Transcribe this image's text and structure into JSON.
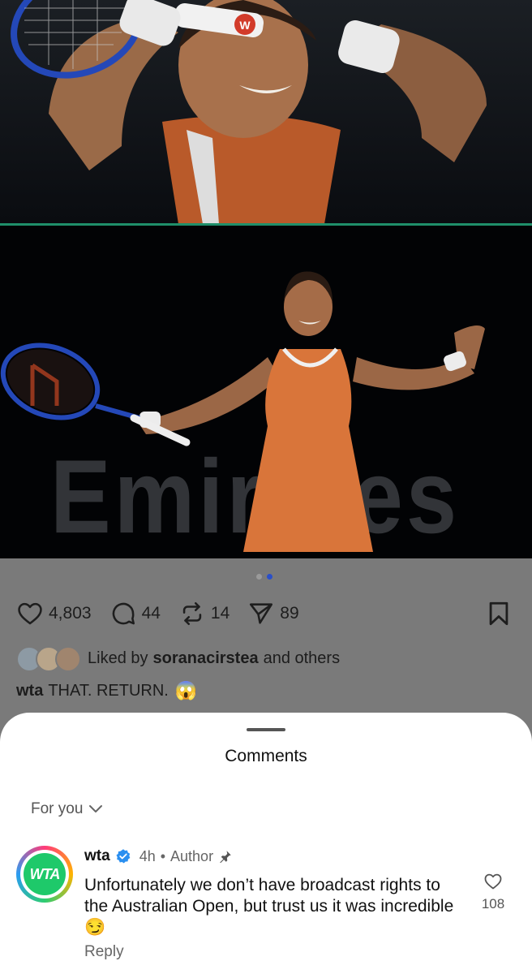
{
  "carousel": {
    "sponsor_text": "Emirates",
    "racket_logo": "W",
    "total_slides": 2,
    "active_slide": 2
  },
  "actions": {
    "likes": "4,803",
    "comments": "44",
    "reposts": "14",
    "shares": "89"
  },
  "liked_by": {
    "prefix": "Liked by",
    "user": "soranacirstea",
    "suffix": "and others"
  },
  "caption": {
    "user": "wta",
    "text": "THAT. RETURN.",
    "emoji": "😱"
  },
  "comments_sheet": {
    "title": "Comments",
    "sort_label": "For you",
    "comment": {
      "avatar_text": "WTA",
      "username": "wta",
      "time": "4h",
      "separator": "•",
      "role": "Author",
      "text": "Unfortunately we don’t have broadcast rights to the Australian Open, but trust us it was incredible",
      "emoji": "😏",
      "likes": "108",
      "reply_label": "Reply"
    }
  },
  "colors": {
    "overlay": "#7a7a7a",
    "accent_blue": "#2a4fc9",
    "wta_green": "#1ec96a",
    "dress_orange": "#d9753a"
  }
}
